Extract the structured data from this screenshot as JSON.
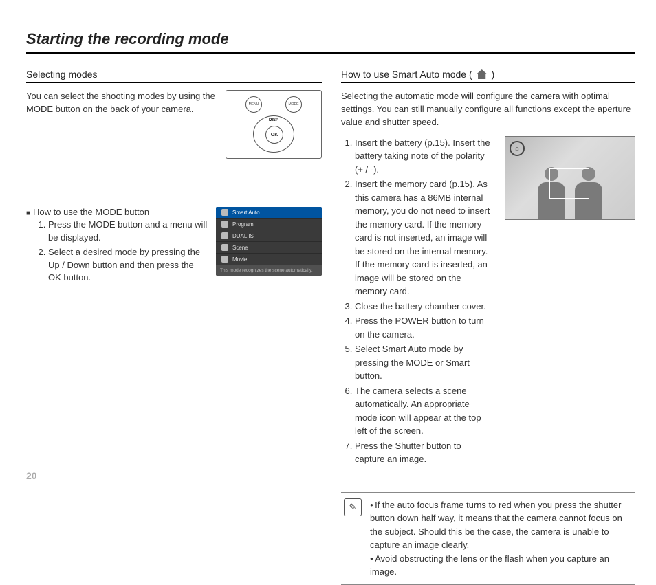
{
  "page_number": "20",
  "title": "Starting the recording mode",
  "left": {
    "heading": "Selecting modes",
    "intro": "You can select the shooting modes by using the MODE button on the back of your camera.",
    "camera": {
      "menu": "MENU",
      "mode": "MODE",
      "disp": "DISP",
      "ok": "OK"
    },
    "howto_title": "How to use the MODE button",
    "howto_1": "Press the MODE button and a menu will be displayed.",
    "howto_2": "Select a desired mode by pressing the Up / Down button and then press the OK button.",
    "menu_items": {
      "i0": "Smart Auto",
      "i1": "Program",
      "i2": "DUAL IS",
      "i3": "Scene",
      "i4": "Movie",
      "footer": "This mode recognizes the scene automatically."
    }
  },
  "right": {
    "heading_a": "How to use Smart Auto mode (",
    "heading_b": ")",
    "intro": "Selecting the automatic mode will configure the camera with optimal settings. You can still manually configure all functions except the aperture value and shutter speed.",
    "s1": "Insert the battery  (p.15). Insert the battery  taking note of the polarity (+ / -).",
    "s2": "Insert the memory card (p.15). As this camera has a 86MB internal memory, you do not need to insert the memory card. If the memory card is not inserted, an image will be stored on the internal memory. If the memory card is inserted, an image will be stored on the memory card.",
    "s3": "Close the battery chamber cover.",
    "s4": "Press the POWER button to turn on the camera.",
    "s5": "Select Smart Auto mode by pressing the MODE or Smart button.",
    "s6": "The camera selects a scene automatically. An appropriate mode icon will appear at the top left of the screen.",
    "s7": "Press the Shutter button to capture an image.",
    "note1": "If the auto focus frame turns to red when you press the shutter button down half way, it means that the camera cannot focus on the subject. Should this be the case, the camera is unable to capture an image clearly.",
    "note2": "Avoid obstructing the lens or the flash when you capture an image."
  }
}
